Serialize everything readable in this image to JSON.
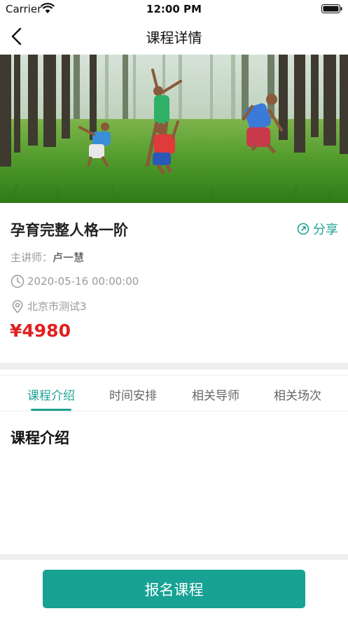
{
  "status_bar": {
    "carrier": "Carrier",
    "time": "12:00 PM"
  },
  "nav": {
    "title": "课程详情"
  },
  "course": {
    "title": "孕育完整人格一阶",
    "share_label": "分享",
    "lecturer_label": "主讲师：",
    "lecturer_name": "卢一慧",
    "datetime": "2020-05-16 00:00:00",
    "location": "北京市测试3",
    "price": "¥4980"
  },
  "tabs": [
    {
      "label": "课程介绍",
      "active": true
    },
    {
      "label": "时间安排",
      "active": false
    },
    {
      "label": "相关导师",
      "active": false
    },
    {
      "label": "相关场次",
      "active": false
    }
  ],
  "content": {
    "section_heading": "课程介绍"
  },
  "footer": {
    "enroll_label": "报名课程"
  },
  "colors": {
    "accent": "#17a294",
    "price": "#e02020",
    "muted": "#9a9a9a"
  }
}
